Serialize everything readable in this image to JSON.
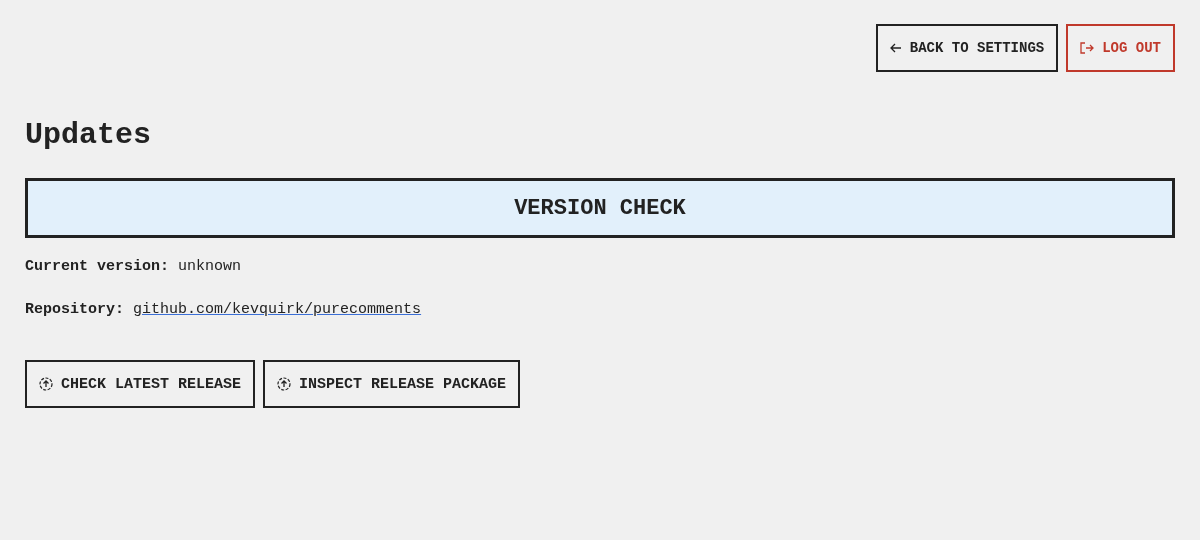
{
  "header_actions": [
    {
      "label": "BACK TO SETTINGS",
      "kind": "back"
    },
    {
      "label": "LOG OUT",
      "kind": "logout"
    }
  ],
  "title": "Updates",
  "section": {
    "title": "VERSION CHECK"
  },
  "info": [
    {
      "label": "Current version:",
      "value": "unknown",
      "kind": "text"
    },
    {
      "label": "Repository:",
      "value": "github.com/kevquirk/purecomments",
      "kind": "link"
    }
  ],
  "actions": [
    {
      "label": "CHECK LATEST RELEASE"
    },
    {
      "label": "INSPECT RELEASE PACKAGE"
    }
  ]
}
